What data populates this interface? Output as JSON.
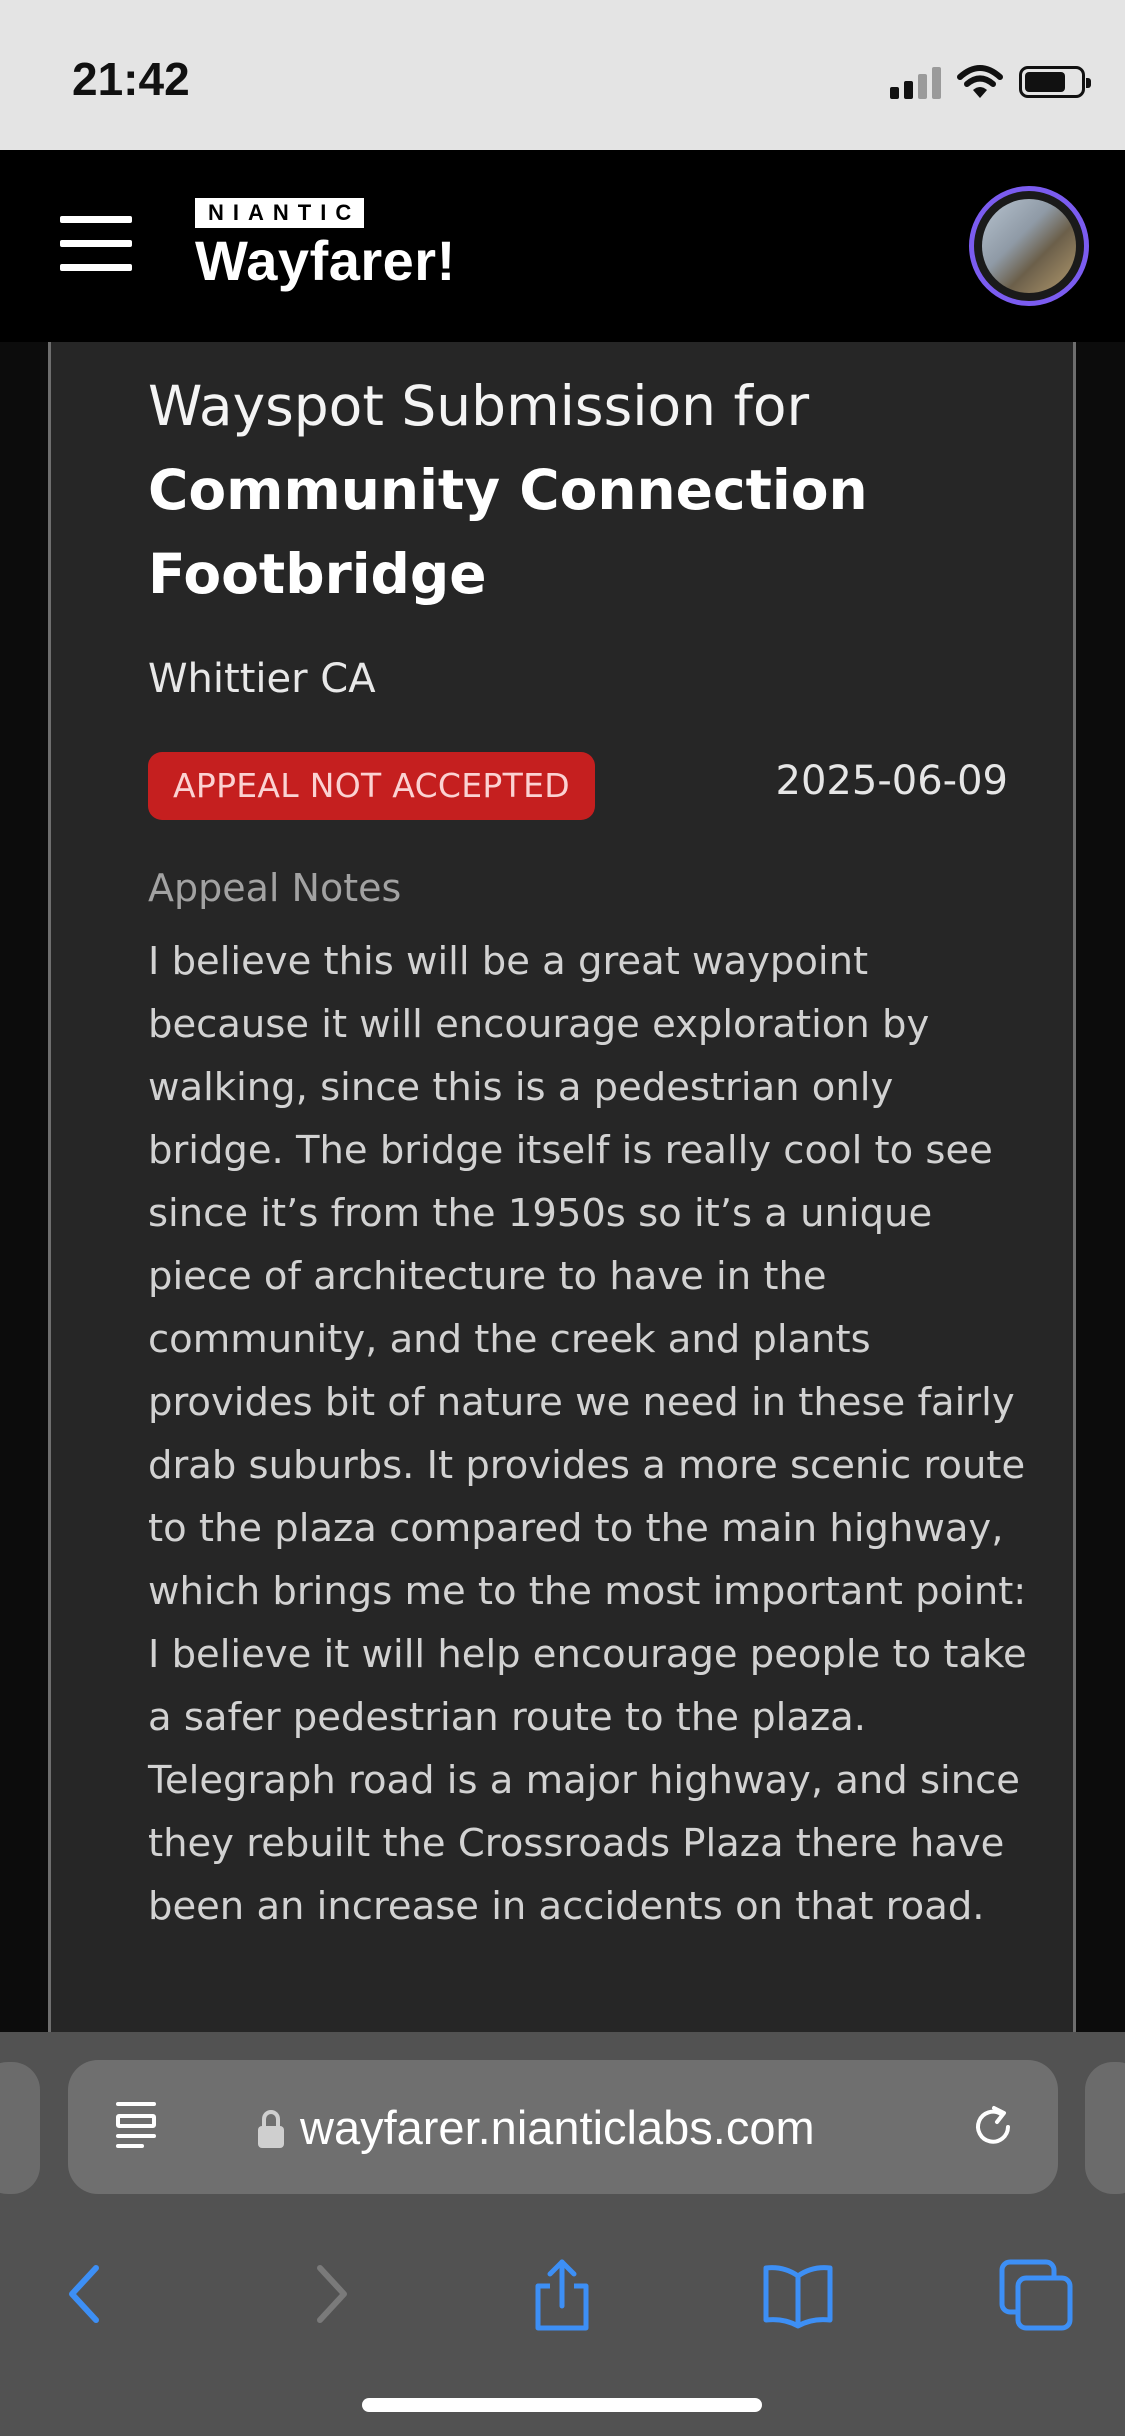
{
  "status_bar": {
    "time": "21:42"
  },
  "header": {
    "brand_small": "NIANTIC",
    "brand": "Wayfarer!"
  },
  "submission": {
    "title_prefix": "Wayspot Submission for",
    "title_name": "Community Connection Footbridge",
    "location": "Whittier CA",
    "status_badge": "APPEAL NOT ACCEPTED",
    "date": "2025-06-09",
    "notes_label": "Appeal Notes",
    "notes_text": "I believe this will be a great waypoint because it will encourage exploration by walking, since this is a pedestrian only bridge. The bridge itself is really cool to see since it’s from the 1950s so it’s a unique piece of architecture to have in the community, and the creek and plants provides bit of nature we need in these fairly drab suburbs. It provides a more scenic route to the plaza compared to the main highway, which brings me to the most important point: I believe it will help encourage people to take a safer pedestrian route to the plaza. Telegraph road is a major highway, and since they rebuilt the Crossroads Plaza there have been an increase in accidents on that road."
  },
  "browser": {
    "url": "wayfarer.nianticlabs.com"
  },
  "colors": {
    "badge_bg": "#c51f1f",
    "accent_blue": "#3d8ff5",
    "avatar_ring": "#7b5cf0",
    "card_bg": "#262626"
  },
  "icons": [
    "menu-icon",
    "user-avatar",
    "reader-mode-icon",
    "lock-icon",
    "reload-icon",
    "back-icon",
    "forward-icon",
    "share-icon",
    "bookmarks-icon",
    "tabs-icon"
  ]
}
